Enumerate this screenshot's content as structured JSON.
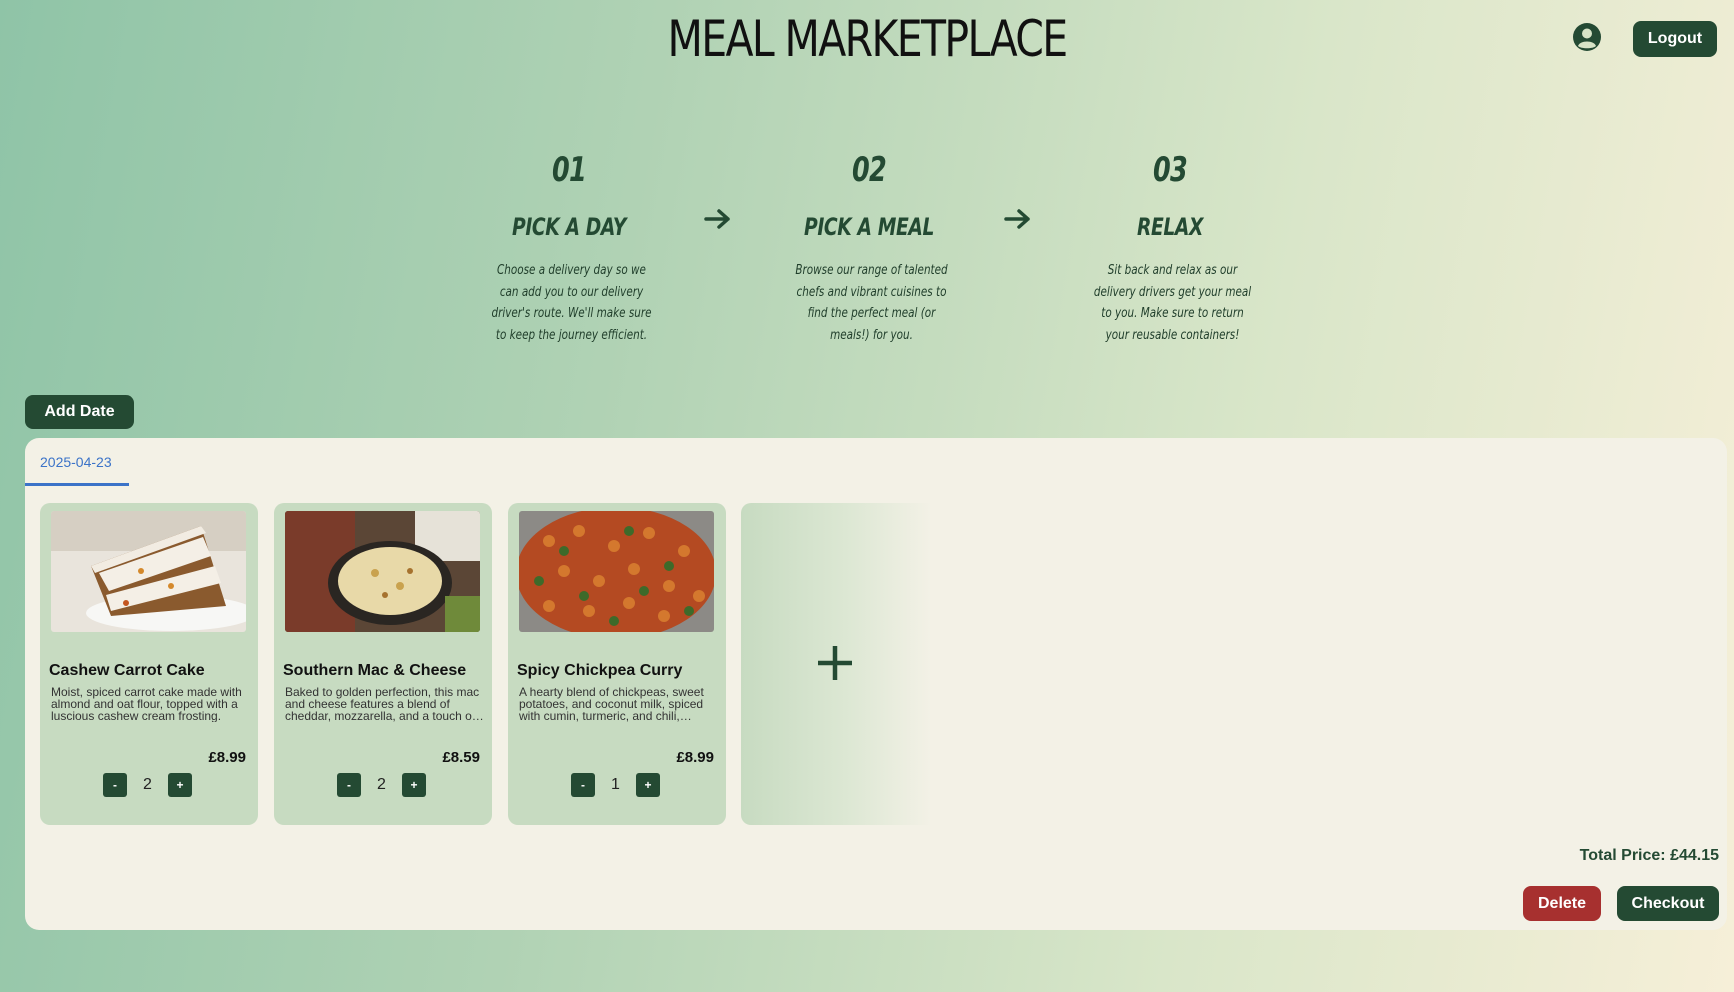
{
  "header": {
    "title": "MEAL MARKETPLACE",
    "account_icon": "user-circle-icon",
    "logout_label": "Logout"
  },
  "steps": [
    {
      "number": "01",
      "heading": "PICK A DAY",
      "description": "Choose a delivery day so we can add you to our delivery driver's route. We'll make sure to keep the journey efficient."
    },
    {
      "number": "02",
      "heading": "PICK A MEAL",
      "description": "Browse our range of talented chefs and vibrant cuisines to find the perfect meal (or meals!) for you."
    },
    {
      "number": "03",
      "heading": "RELAX",
      "description": "Sit back and relax as our delivery drivers get your meal to you. Make sure to return your reusable containers!"
    }
  ],
  "add_date_label": "Add Date",
  "date_tabs": [
    "2025-04-23"
  ],
  "meals": [
    {
      "name": "Cashew Carrot Cake",
      "description": "Moist, spiced carrot cake made with almond and oat flour, topped with a luscious cashew cream frosting.",
      "price": "£8.99",
      "quantity": "2",
      "minus": "-",
      "plus": "+"
    },
    {
      "name": "Southern Mac & Cheese",
      "description": "Baked to golden perfection, this mac and cheese features a blend of cheddar, mozzarella, and a touch of smoked paprika.",
      "price": "£8.59",
      "quantity": "2",
      "minus": "-",
      "plus": "+"
    },
    {
      "name": "Spicy Chickpea Curry",
      "description": "A hearty blend of chickpeas, sweet potatoes, and coconut milk, spiced with cumin, turmeric, and chili, served warm.",
      "price": "£8.99",
      "quantity": "1",
      "minus": "-",
      "plus": "+"
    }
  ],
  "add_meal_icon": "plus-icon",
  "total_price": "Total Price: £44.15",
  "delete_label": "Delete",
  "checkout_label": "Checkout",
  "colors": {
    "accent": "#244a33",
    "danger": "#a7302f",
    "tab": "#3b73c8",
    "card": "#c7dbc1",
    "panel": "#f3f1e6"
  }
}
